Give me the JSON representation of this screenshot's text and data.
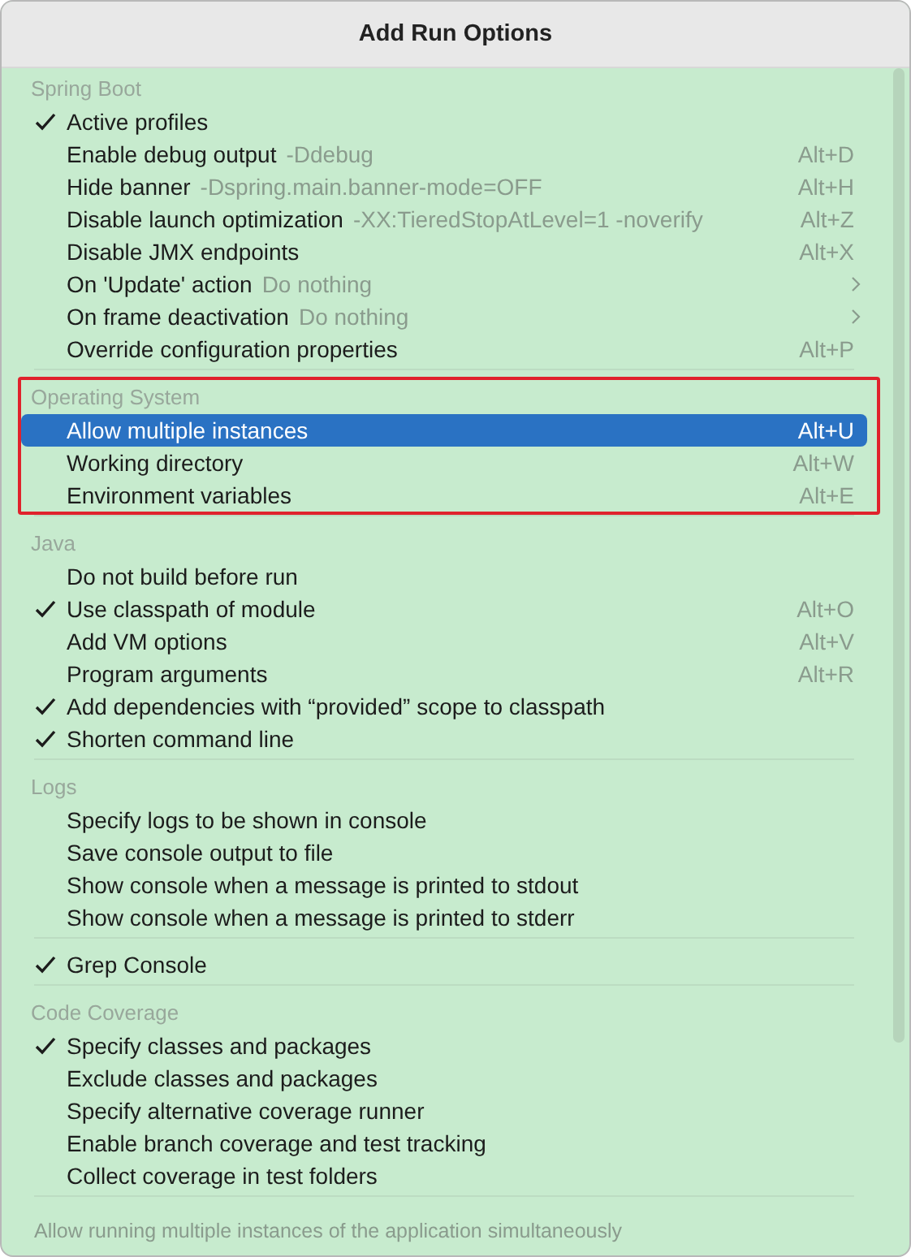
{
  "window": {
    "title": "Add Run Options"
  },
  "groups": [
    {
      "title": "Spring Boot",
      "highlighted": false,
      "items": [
        {
          "label": "Active profiles",
          "checked": true,
          "selected": false,
          "kind": "action"
        },
        {
          "label": "Enable debug output",
          "hint": "-Ddebug",
          "shortcut": "Alt+D",
          "checked": false,
          "selected": false,
          "kind": "action"
        },
        {
          "label": "Hide banner",
          "hint": "-Dspring.main.banner-mode=OFF",
          "shortcut": "Alt+H",
          "checked": false,
          "selected": false,
          "kind": "action"
        },
        {
          "label": "Disable launch optimization",
          "hint": "-XX:TieredStopAtLevel=1 -noverify",
          "shortcut": "Alt+Z",
          "checked": false,
          "selected": false,
          "kind": "action"
        },
        {
          "label": "Disable JMX endpoints",
          "shortcut": "Alt+X",
          "checked": false,
          "selected": false,
          "kind": "action"
        },
        {
          "label": "On 'Update' action",
          "hint": "Do nothing",
          "checked": false,
          "selected": false,
          "kind": "submenu"
        },
        {
          "label": "On frame deactivation",
          "hint": "Do nothing",
          "checked": false,
          "selected": false,
          "kind": "submenu"
        },
        {
          "label": "Override configuration properties",
          "shortcut": "Alt+P",
          "checked": false,
          "selected": false,
          "kind": "action"
        }
      ]
    },
    {
      "title": "Operating System",
      "highlighted": true,
      "items": [
        {
          "label": "Allow multiple instances",
          "shortcut": "Alt+U",
          "checked": false,
          "selected": true,
          "kind": "action"
        },
        {
          "label": "Working directory",
          "shortcut": "Alt+W",
          "checked": false,
          "selected": false,
          "kind": "action"
        },
        {
          "label": "Environment variables",
          "shortcut": "Alt+E",
          "checked": false,
          "selected": false,
          "kind": "action"
        }
      ]
    },
    {
      "title": "Java",
      "highlighted": false,
      "items": [
        {
          "label": "Do not build before run",
          "checked": false,
          "selected": false,
          "kind": "action"
        },
        {
          "label": "Use classpath of module",
          "shortcut": "Alt+O",
          "checked": true,
          "selected": false,
          "kind": "action"
        },
        {
          "label": "Add VM options",
          "shortcut": "Alt+V",
          "checked": false,
          "selected": false,
          "kind": "action"
        },
        {
          "label": "Program arguments",
          "shortcut": "Alt+R",
          "checked": false,
          "selected": false,
          "kind": "action"
        },
        {
          "label": "Add dependencies with “provided” scope to classpath",
          "checked": true,
          "selected": false,
          "kind": "action"
        },
        {
          "label": "Shorten command line",
          "checked": true,
          "selected": false,
          "kind": "action"
        }
      ]
    },
    {
      "title": "Logs",
      "highlighted": false,
      "items": [
        {
          "label": "Specify logs to be shown in console",
          "checked": false,
          "selected": false,
          "kind": "action"
        },
        {
          "label": "Save console output to file",
          "checked": false,
          "selected": false,
          "kind": "action"
        },
        {
          "label": "Show console when a message is printed to stdout",
          "checked": false,
          "selected": false,
          "kind": "action"
        },
        {
          "label": "Show console when a message is printed to stderr",
          "checked": false,
          "selected": false,
          "kind": "action"
        }
      ]
    },
    {
      "highlighted": false,
      "items": [
        {
          "label": "Grep Console",
          "checked": true,
          "selected": false,
          "kind": "action"
        }
      ]
    },
    {
      "title": "Code Coverage",
      "highlighted": false,
      "items": [
        {
          "label": "Specify classes and packages",
          "checked": true,
          "selected": false,
          "kind": "action"
        },
        {
          "label": "Exclude classes and packages",
          "checked": false,
          "selected": false,
          "kind": "action"
        },
        {
          "label": "Specify alternative coverage runner",
          "checked": false,
          "selected": false,
          "kind": "action"
        },
        {
          "label": "Enable branch coverage and test tracking",
          "checked": false,
          "selected": false,
          "kind": "action"
        },
        {
          "label": "Collect coverage in test folders",
          "checked": false,
          "selected": false,
          "kind": "action"
        }
      ]
    }
  ],
  "status_bar": {
    "text": "Allow running multiple instances of the application simultaneously"
  }
}
